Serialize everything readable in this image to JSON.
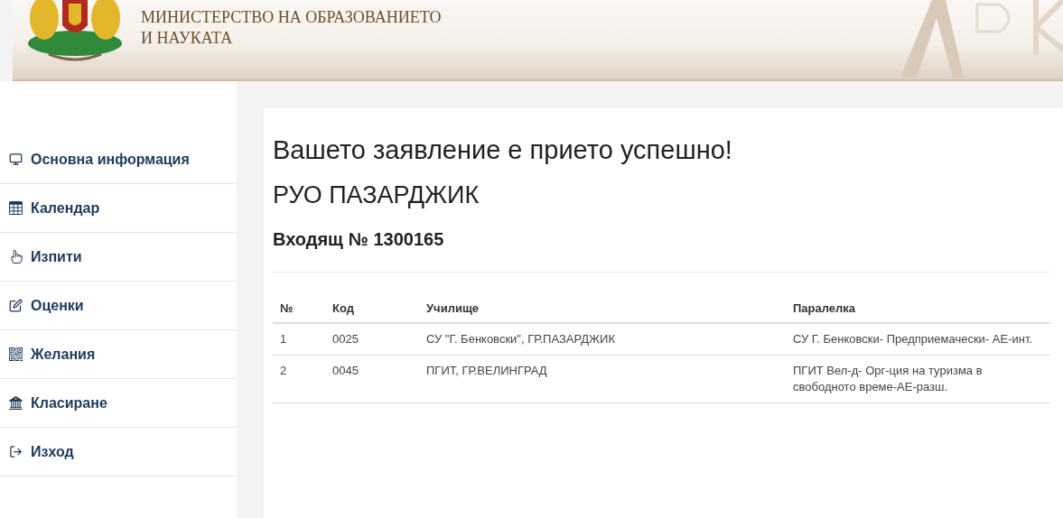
{
  "header": {
    "ministry_line_1": "МИНИСТЕРСТВО НА ОБРАЗОВАНИЕТО",
    "ministry_line_2": "И НАУКАТА"
  },
  "sidebar": {
    "items": [
      {
        "label": "Основна информация"
      },
      {
        "label": "Календар"
      },
      {
        "label": "Изпити"
      },
      {
        "label": "Оценки"
      },
      {
        "label": "Желания"
      },
      {
        "label": "Класиране"
      },
      {
        "label": "Изход"
      }
    ]
  },
  "content": {
    "message": "Вашето заявление е прието успешно!",
    "office": "РУО ПАЗАРДЖИК",
    "incoming": "Входящ № 1300165",
    "table": {
      "columns": [
        "№",
        "Код",
        "Училище",
        "Паралелка"
      ],
      "rows": [
        [
          "1",
          "0025",
          "СУ \"Г. Бенковски\", ГР.ПАЗАРДЖИК",
          "СУ Г. Бенковски- Предприемачески- АЕ-инт."
        ],
        [
          "2",
          "0045",
          "ПГИТ, ГР.ВЕЛИНГРАД",
          "ПГИТ Вел-д- Орг-ция на туризма в свободното време-АЕ-разш."
        ]
      ]
    }
  }
}
